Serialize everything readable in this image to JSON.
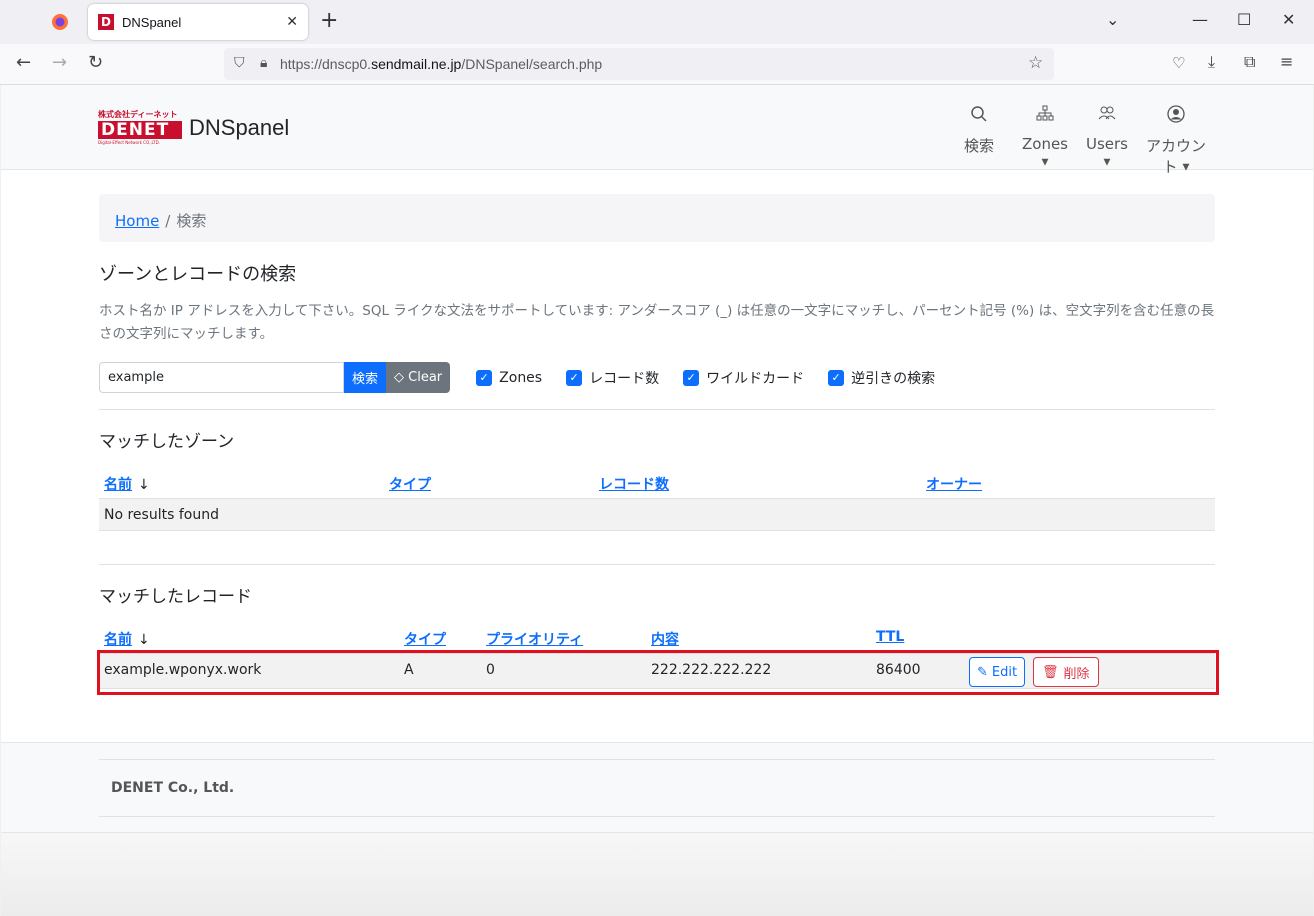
{
  "browser": {
    "tab_title": "DNSpanel",
    "url_prefix": "https://dnscp0.",
    "url_domain": "sendmail.ne.jp",
    "url_path": "/DNSpanel/search.php"
  },
  "header": {
    "logo_top": "株式会社ディーネット",
    "logo_mid": "DENET",
    "logo_bottom": "Digital-Effect Network CO.,LTD.",
    "brand": "DNSpanel",
    "nav": {
      "search": "検索",
      "zones": "Zones",
      "users": "Users",
      "account": "アカウント"
    }
  },
  "breadcrumb": {
    "home": "Home",
    "separator": "/",
    "current": "検索"
  },
  "search": {
    "heading": "ゾーンとレコードの検索",
    "description": "ホスト名か IP アドレスを入力して下さい。SQL ライクな文法をサポートしています: アンダースコア (_) は任意の一文字にマッチし、パーセント記号 (%) は、空文字列を含む任意の長さの文字列にマッチします。",
    "input_value": "example",
    "search_button": "検索",
    "clear_button": "Clear",
    "checkboxes": [
      "Zones",
      "レコード数",
      "ワイルドカード",
      "逆引きの検索"
    ]
  },
  "zones": {
    "heading": "マッチしたゾーン",
    "columns": [
      "名前",
      "タイプ",
      "レコード数",
      "オーナー"
    ],
    "sort_arrow": "↓",
    "empty": "No results found"
  },
  "records": {
    "heading": "マッチしたレコード",
    "columns": [
      "名前",
      "タイプ",
      "プライオリティ",
      "内容",
      "TTL"
    ],
    "sort_arrow": "↓",
    "rows": [
      {
        "name": "example.wponyx.work",
        "type": "A",
        "priority": "0",
        "content": "222.222.222.222",
        "ttl": "86400"
      }
    ],
    "edit_label": "Edit",
    "delete_label": "削除"
  },
  "footer": {
    "text": "DENET Co., Ltd."
  },
  "colors": {
    "primary": "#0d6efd",
    "danger": "#dc3545",
    "highlight": "#e0101f",
    "brand_red": "#c8102e"
  }
}
